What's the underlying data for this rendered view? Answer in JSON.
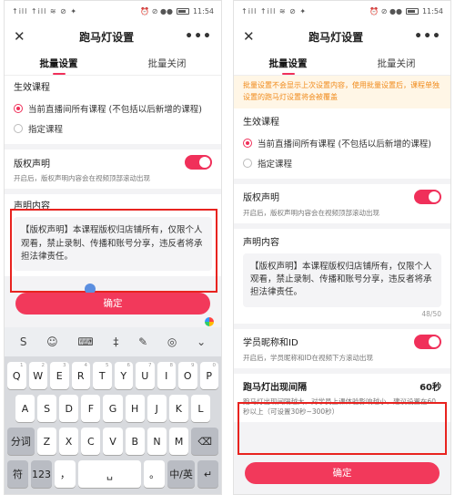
{
  "status_bar": {
    "left": "↑ill ↑ill ≋ ⊘ ✦",
    "time": "11:54",
    "icons": "⏰ ⊘ ●●"
  },
  "appbar": {
    "title": "跑马灯设置",
    "close": "✕",
    "more": "•••"
  },
  "tabs": [
    {
      "label": "批量设置",
      "active": true
    },
    {
      "label": "批量关闭",
      "active": false
    }
  ],
  "notice": "批量设置不会显示上次设置内容，使用批量设置后，课程单独设置的跑马灯设置将会被覆盖",
  "effective_course": {
    "title": "生效课程",
    "options": [
      "当前直播间所有课程 (不包括以后新增的课程)",
      "指定课程"
    ],
    "selected": 0
  },
  "copyright": {
    "title": "版权声明",
    "enabled": true,
    "hint": "开启后，版权声明内容会在视频顶部滚动出现"
  },
  "statement": {
    "title": "声明内容",
    "text": "【版权声明】本课程版权归店铺所有，仅限个人观看，禁止录制、传播和账号分享，违反者将承担法律责任。",
    "counter": "48/50"
  },
  "student_id": {
    "title": "学员昵称和ID",
    "enabled": true,
    "hint": "开启后，学员昵称和ID在视频下方滚动出现"
  },
  "interval": {
    "title": "跑马灯出现间隔",
    "value": "60秒",
    "hint": "跑马灯出现间隔越大，对学员上课体验影响越小，建议设置在60秒以上（可设置30秒~300秒）"
  },
  "confirm_label": "确定",
  "keyboard": {
    "toolbar": [
      "S",
      "☺",
      "⌨",
      "‡",
      "✎",
      "◎",
      "⌄"
    ],
    "row1": [
      [
        "Q",
        "1"
      ],
      [
        "W",
        "2"
      ],
      [
        "E",
        "3"
      ],
      [
        "R",
        "4"
      ],
      [
        "T",
        "5"
      ],
      [
        "Y",
        "6"
      ],
      [
        "U",
        "7"
      ],
      [
        "I",
        "8"
      ],
      [
        "O",
        "9"
      ],
      [
        "P",
        "0"
      ]
    ],
    "row2": [
      [
        "A",
        ""
      ],
      [
        "S",
        ""
      ],
      [
        "D",
        ""
      ],
      [
        "F",
        ""
      ],
      [
        "G",
        ""
      ],
      [
        "H",
        ""
      ],
      [
        "J",
        ""
      ],
      [
        "K",
        ""
      ],
      [
        "L",
        ""
      ]
    ],
    "row3": [
      "分词",
      "Z",
      "X",
      "C",
      "V",
      "B",
      "N",
      "M",
      "⌫"
    ],
    "row4": [
      "符",
      "123",
      "，",
      "␣",
      "。",
      "中/英",
      "↵"
    ]
  }
}
